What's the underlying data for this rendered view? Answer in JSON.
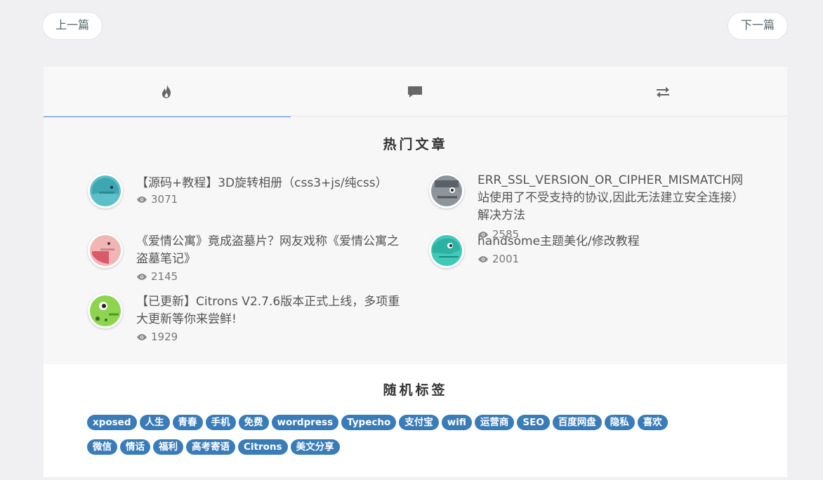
{
  "pager": {
    "prev": "上一篇",
    "next": "下一篇"
  },
  "tabs": [
    {
      "icon": "fire-icon",
      "active": true
    },
    {
      "icon": "comment-icon",
      "active": false
    },
    {
      "icon": "exchange-icon",
      "active": false
    }
  ],
  "hot": {
    "title": "热门文章",
    "posts": [
      {
        "title": "【源码+教程】3D旋转相册（css3+js/纯css）",
        "views": "3071"
      },
      {
        "title": "ERR_SSL_VERSION_OR_CIPHER_MISMATCH网站使用了不受支持的协议,因此无法建立安全连接）解决方法",
        "views": "2585"
      },
      {
        "title": "《爱情公寓》竟成盗墓片？网友戏称《爱情公寓之盗墓笔记》",
        "views": "2145"
      },
      {
        "title": "handsome主题美化/修改教程",
        "views": "2001"
      },
      {
        "title": "【已更新】Citrons V2.7.6版本正式上线，多项重大更新等你来尝鲜!",
        "views": "1929"
      }
    ]
  },
  "tags": {
    "title": "随机标签",
    "items": [
      "xposed",
      "人生",
      "青春",
      "手机",
      "免费",
      "wordpress",
      "Typecho",
      "支付宝",
      "wifi",
      "运营商",
      "SEO",
      "百度网盘",
      "隐私",
      "喜欢",
      "微信",
      "情话",
      "福利",
      "高考寄语",
      "Citrons",
      "美文分享"
    ],
    "color": "#3a7cb8"
  }
}
